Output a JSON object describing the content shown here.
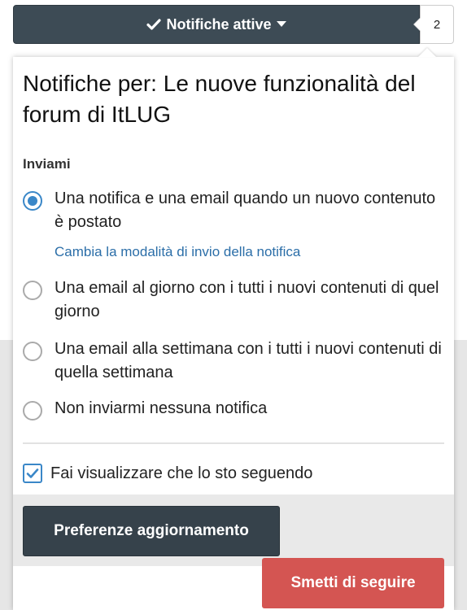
{
  "topbar": {
    "follow_label": "Notifiche attive",
    "count": "2"
  },
  "panel": {
    "title": "Notifiche per: Le nuove funzionalità del forum di ItLUG",
    "section_label": "Inviami",
    "options": [
      {
        "label": "Una notifica e una email quando un nuovo contenuto è postato",
        "checked": true
      },
      {
        "label": "Una email al giorno con i tutti i nuovi contenuti di quel giorno",
        "checked": false
      },
      {
        "label": "Una email alla settimana con i tutti i nuovi contenuti di quella settimana",
        "checked": false
      },
      {
        "label": "Non inviarmi nessuna notifica",
        "checked": false
      }
    ],
    "change_link": "Cambia la modalità di invio della notifica",
    "show_following_label": "Fai visualizzare che lo sto seguendo",
    "show_following_checked": true,
    "update_button": "Preferenze aggiornamento",
    "unfollow_button": "Smetti di seguire"
  },
  "colors": {
    "primary_dark": "#36424b",
    "accent_blue": "#3a87c8",
    "danger_red": "#d45552",
    "link_blue": "#2b6ea8"
  },
  "icons": {
    "follow": "check-icon",
    "dropdown": "caret-down-icon",
    "checkbox": "checkmark-icon"
  }
}
